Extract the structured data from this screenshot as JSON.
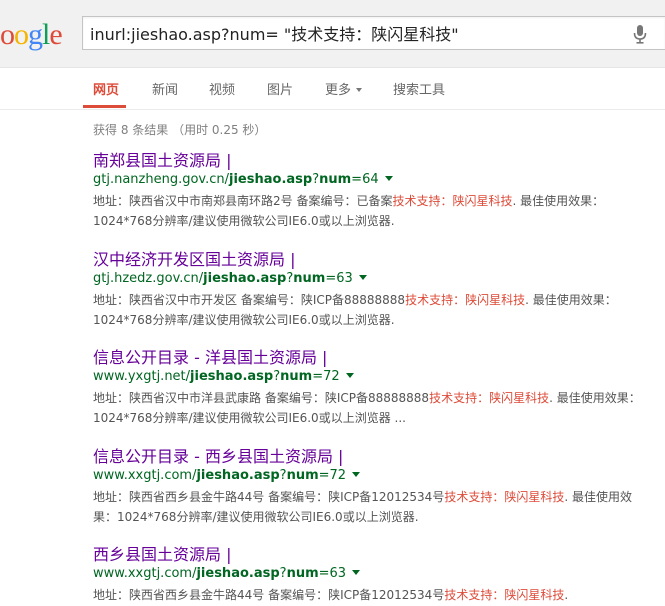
{
  "logo": {
    "letters": [
      {
        "ch": "o",
        "color": "#dd4b39"
      },
      {
        "ch": "o",
        "color": "#f4b400"
      },
      {
        "ch": "g",
        "color": "#4285f4"
      },
      {
        "ch": "l",
        "color": "#0f9d58"
      },
      {
        "ch": "e",
        "color": "#dd4b39"
      }
    ]
  },
  "search": {
    "query": "inurl:jieshao.asp?num= \"技术支持：陕闪星科技\""
  },
  "tabs": [
    {
      "label": "网页",
      "active": true
    },
    {
      "label": "新闻",
      "active": false
    },
    {
      "label": "视频",
      "active": false
    },
    {
      "label": "图片",
      "active": false
    },
    {
      "label": "更多",
      "active": false,
      "has_caret": true
    },
    {
      "label": "搜索工具",
      "active": false
    }
  ],
  "stats": "获得 8 条结果 （用时 0.25 秒）",
  "results": [
    {
      "title": "南郑县国土资源局 |",
      "url_host": "gtj.nanzheng.gov.cn/",
      "url_bold": "jieshao.asp",
      "url_mid": "?",
      "url_bold2": "num",
      "url_tail": "=64",
      "snippet_pre": "地址：陕西省汉中市南郑县南环路2号 备案编号：已备案",
      "snippet_hl": "技术支持：陕闪星科技",
      "snippet_post": ". 最佳使用效果：1024*768分辨率/建议使用微软公司IE6.0或以上浏览器."
    },
    {
      "title": "汉中经济开发区国土资源局 |",
      "url_host": "gtj.hzedz.gov.cn/",
      "url_bold": "jieshao.asp",
      "url_mid": "?",
      "url_bold2": "num",
      "url_tail": "=63",
      "snippet_pre": "地址：陕西省汉中市开发区 备案编号：陕ICP备88888888",
      "snippet_hl": "技术支持：陕闪星科技",
      "snippet_post": ". 最佳使用效果：1024*768分辨率/建议使用微软公司IE6.0或以上浏览器."
    },
    {
      "title": "信息公开目录 - 洋县国土资源局 |",
      "url_host": "www.yxgtj.net/",
      "url_bold": "jieshao.asp",
      "url_mid": "?",
      "url_bold2": "num",
      "url_tail": "=72",
      "snippet_pre": "地址：陕西省汉中市洋县武康路 备案编号：陕ICP备88888888",
      "snippet_hl": "技术支持：陕闪星科技",
      "snippet_post": ". 最佳使用效果：1024*768分辨率/建议使用微软公司IE6.0或以上浏览器 ..."
    },
    {
      "title": "信息公开目录 - 西乡县国土资源局 |",
      "url_host": "www.xxgtj.com/",
      "url_bold": "jieshao.asp",
      "url_mid": "?",
      "url_bold2": "num",
      "url_tail": "=72",
      "snippet_pre": "地址：陕西省西乡县金牛路44号 备案编号：陕ICP备12012534号",
      "snippet_hl": "技术支持：陕闪星科技",
      "snippet_post": ". 最佳使用效果：1024*768分辨率/建议使用微软公司IE6.0或以上浏览器."
    },
    {
      "title": "西乡县国土资源局 |",
      "url_host": "www.xxgtj.com/",
      "url_bold": "jieshao.asp",
      "url_mid": "?",
      "url_bold2": "num",
      "url_tail": "=63",
      "snippet_pre": "地址：陕西省西乡县金牛路44号 备案编号：陕ICP备12012534号",
      "snippet_hl": "技术支持：陕闪星科技",
      "snippet_post": "."
    }
  ]
}
